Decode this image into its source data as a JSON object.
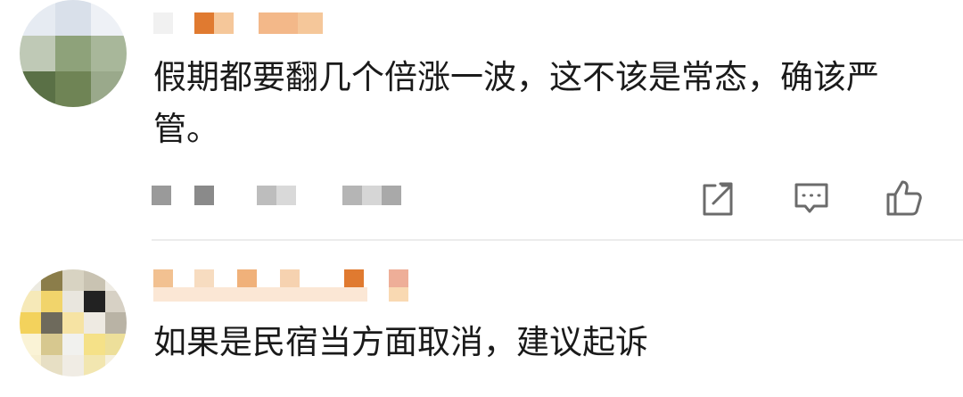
{
  "comments": [
    {
      "text": "假期都要翻几个倍涨一波，这不该是常态，确该严管。"
    },
    {
      "text": "如果是民宿当方面取消，建议起诉"
    }
  ],
  "actions": {
    "share_icon": "share-icon",
    "comment_icon": "comment-icon",
    "like_icon": "thumbs-up-icon"
  },
  "colors": {
    "text": "#1a1a1a",
    "icon": "#6b6b6b",
    "divider": "#ececec",
    "name_orange": "#e07a30",
    "name_peach": "#f5c79a"
  }
}
